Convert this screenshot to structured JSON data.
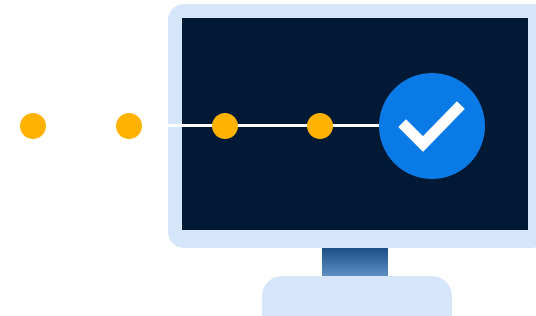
{
  "colors": {
    "dot": "#ffb300",
    "check_badge": "#0a7be6",
    "check_mark": "#ffffff",
    "screen": "#011935",
    "monitor_frame": "#d6e6fa"
  },
  "progress_steps": {
    "total_dots": 4,
    "status_icon": "check-icon"
  }
}
